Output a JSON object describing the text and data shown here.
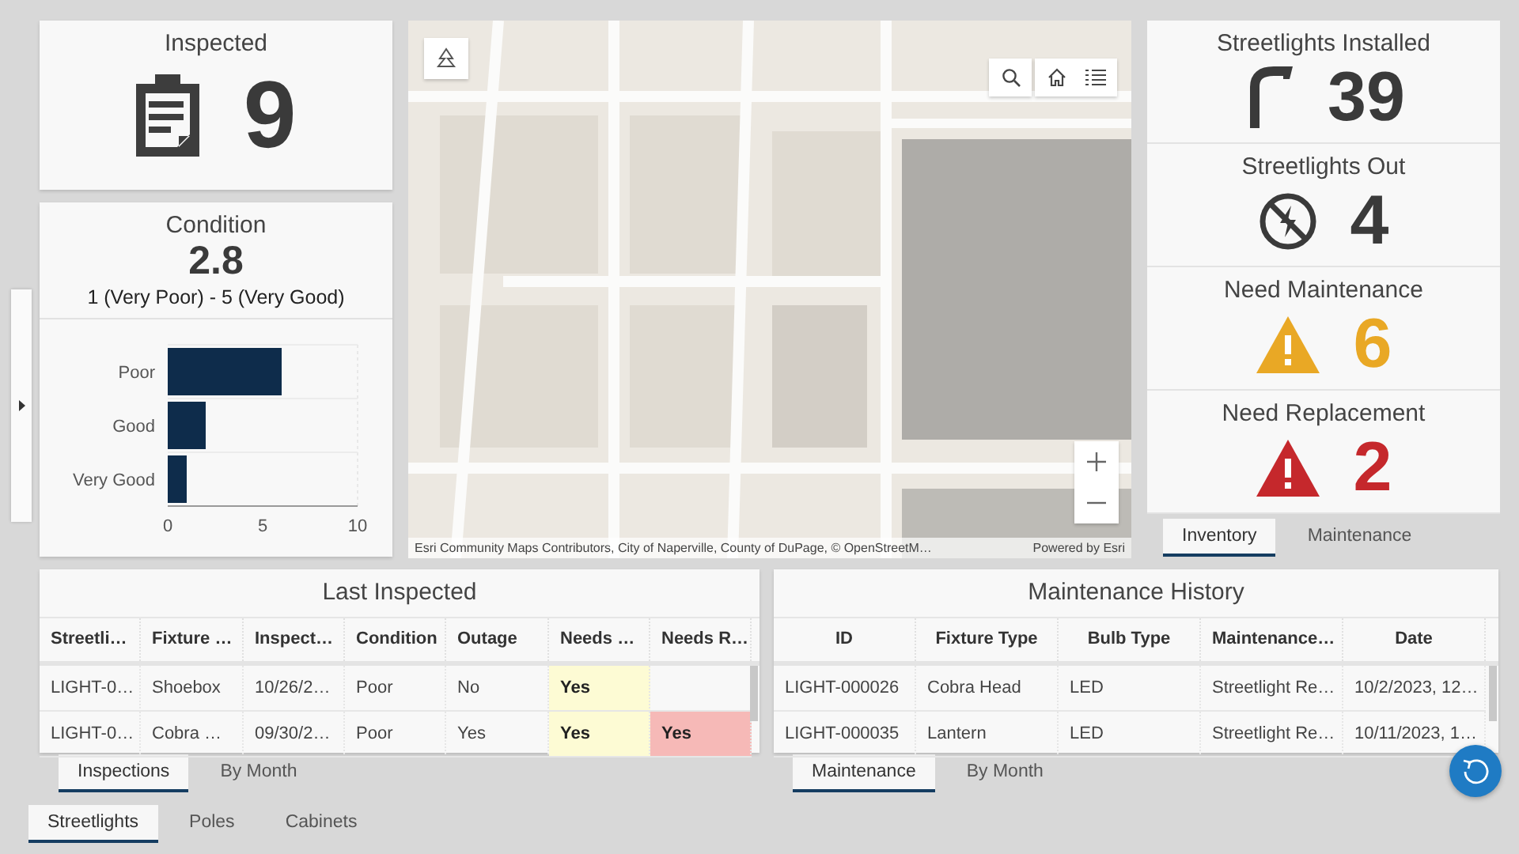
{
  "inspected": {
    "title": "Inspected",
    "value": "9"
  },
  "condition": {
    "title": "Condition",
    "value": "2.8",
    "subtitle": "1 (Very Poor) - 5 (Very Good)",
    "chart_data": {
      "type": "bar",
      "orientation": "horizontal",
      "categories": [
        "Poor",
        "Good",
        "Very Good"
      ],
      "values": [
        6,
        2,
        1
      ],
      "xlim": [
        0,
        10
      ],
      "xticks": [
        0,
        5,
        10
      ]
    }
  },
  "map": {
    "attribution": "Esri Community Maps Contributors, City of Naperville, County of DuPage, © OpenStreetM…",
    "powered_by": "Powered by Esri"
  },
  "indicators": [
    {
      "kind": "streetlight",
      "title": "Streetlights Installed",
      "value": "39",
      "color": "#3a3a3a"
    },
    {
      "kind": "outage",
      "title": "Streetlights Out",
      "value": "4",
      "color": "#3a3a3a"
    },
    {
      "kind": "warning",
      "title": "Need Maintenance",
      "value": "6",
      "color": "#e9a825"
    },
    {
      "kind": "warning",
      "title": "Need Replacement",
      "value": "2",
      "color": "#c5282c"
    }
  ],
  "indicator_tabs": [
    {
      "label": "Inventory",
      "selected": true
    },
    {
      "label": "Maintenance",
      "selected": false
    }
  ],
  "last_inspected": {
    "title": "Last Inspected",
    "columns": [
      "Streetli…",
      "Fixture …",
      "Inspect…",
      "Condition",
      "Outage",
      "Needs …",
      "Needs R…"
    ],
    "rows": [
      [
        "LIGHT-0…",
        "Shoebox",
        "10/26/2…",
        "Poor",
        "No",
        {
          "text": "Yes",
          "color": "#fdfbd4"
        },
        null
      ],
      [
        "LIGHT-0…",
        "Cobra …",
        "09/30/2…",
        "Poor",
        "Yes",
        {
          "text": "Yes",
          "color": "#fdfbd4"
        },
        {
          "text": "Yes",
          "color": "#f6b9b7"
        }
      ]
    ]
  },
  "last_inspected_tabs": [
    {
      "label": "Inspections",
      "selected": true
    },
    {
      "label": "By Month",
      "selected": false
    }
  ],
  "maintenance_history": {
    "title": "Maintenance History",
    "columns": [
      "ID",
      "Fixture Type",
      "Bulb Type",
      "Maintenance…",
      "Date"
    ],
    "rows": [
      [
        "LIGHT-000026",
        "Cobra Head",
        "LED",
        "Streetlight Re…",
        "10/2/2023, 12…"
      ],
      [
        "LIGHT-000035",
        "Lantern",
        "LED",
        "Streetlight Re…",
        "10/11/2023, 1…"
      ]
    ]
  },
  "maintenance_tabs": [
    {
      "label": "Maintenance",
      "selected": true
    },
    {
      "label": "By Month",
      "selected": false
    }
  ],
  "layer_tabs": [
    {
      "label": "Streetlights",
      "selected": true
    },
    {
      "label": "Poles",
      "selected": false
    },
    {
      "label": "Cabinets",
      "selected": false
    }
  ]
}
